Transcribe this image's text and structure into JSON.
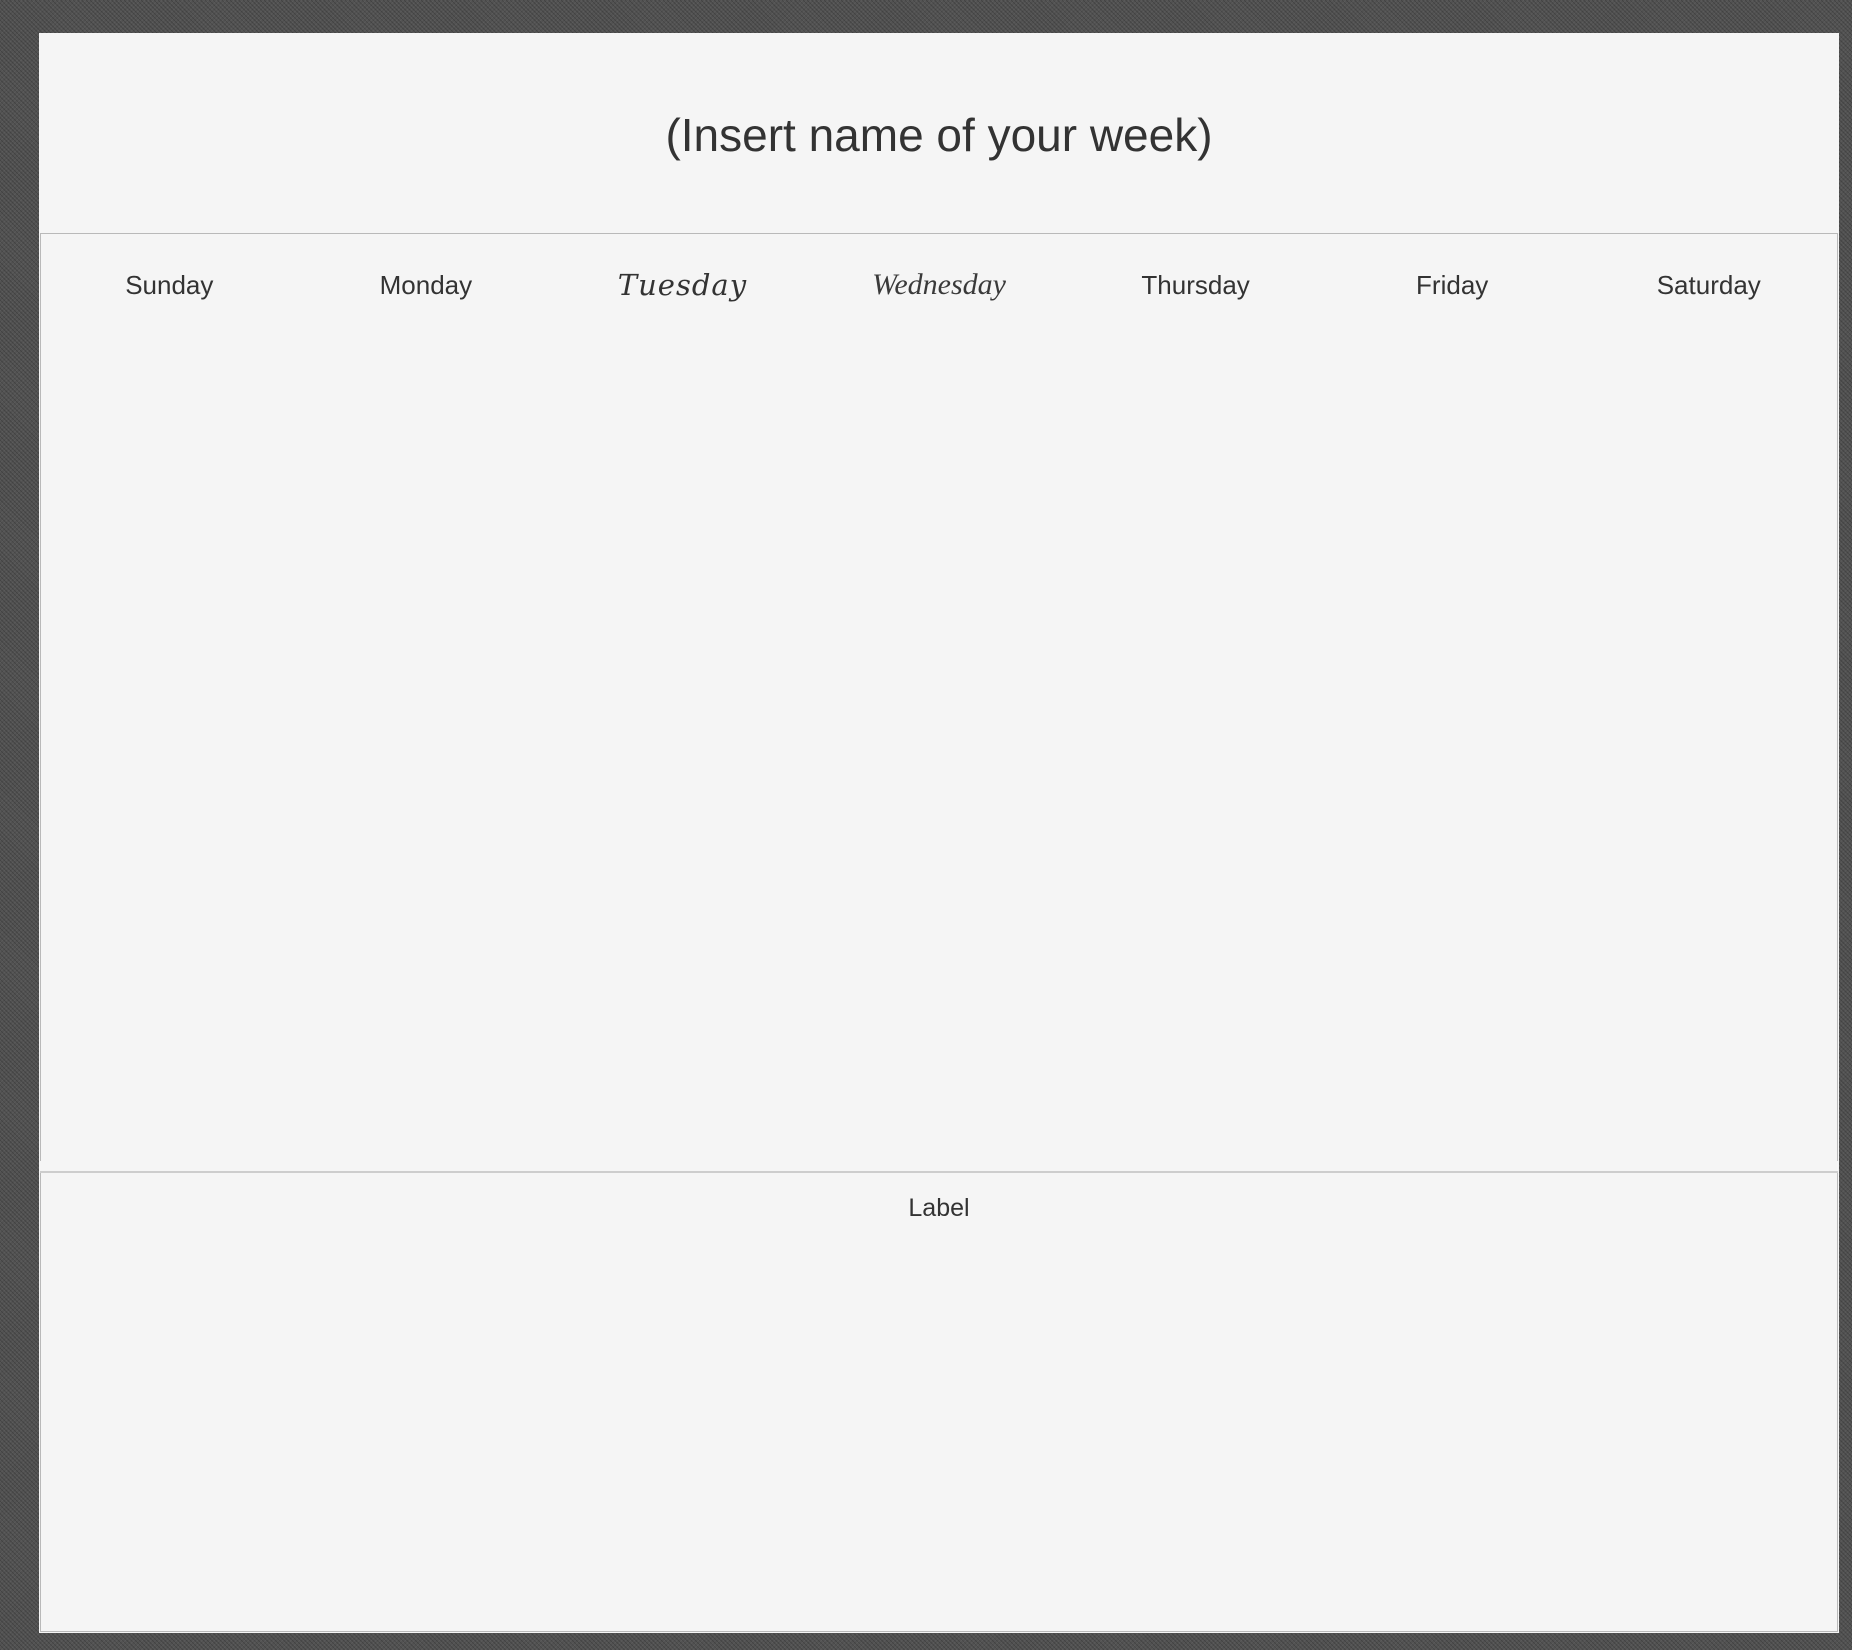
{
  "page": {
    "title": "(Insert name of your week)"
  },
  "week": {
    "days": [
      {
        "label": "Sunday"
      },
      {
        "label": "Monday"
      },
      {
        "label": "Tuesday"
      },
      {
        "label": "Wednesday"
      },
      {
        "label": "Thursday"
      },
      {
        "label": "Friday"
      },
      {
        "label": "Saturday"
      }
    ]
  },
  "notes": {
    "label": "Label"
  },
  "colors": {
    "background": "#525252",
    "canvas": "#f5f5f5",
    "text": "#333333",
    "border": "#b9b9b9"
  }
}
